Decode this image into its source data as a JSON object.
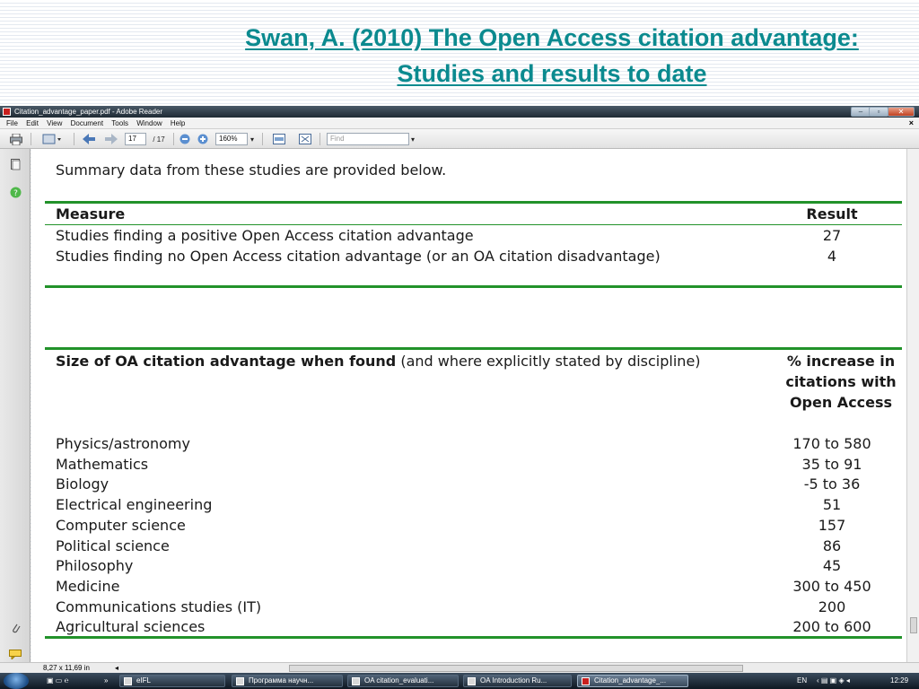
{
  "slide": {
    "title_line1": "Swan, A. (2010) The Open Access citation advantage:",
    "title_line2": "Studies and results to date"
  },
  "window": {
    "title": "Citation_advantage_paper.pdf - Adobe Reader",
    "minimize": "–",
    "maximize": "▫",
    "close": "✕"
  },
  "menu": {
    "items": [
      "File",
      "Edit",
      "View",
      "Document",
      "Tools",
      "Window",
      "Help"
    ],
    "close": "×"
  },
  "toolbar": {
    "page_current": "17",
    "page_total": "/ 17",
    "zoom": "160%",
    "find_placeholder": "Find"
  },
  "document": {
    "intro": "Summary data from these studies are provided below.",
    "table1": {
      "headers": [
        "Measure",
        "Result"
      ],
      "rows": [
        [
          "Studies finding a positive Open Access citation advantage",
          "27"
        ],
        [
          "Studies finding no Open Access citation advantage (or an OA citation disadvantage)",
          "4"
        ]
      ]
    },
    "table2": {
      "header_bold": "Size of OA citation advantage when found",
      "header_rest": " (and where explicitly stated by discipline)",
      "result_header": "% increase in citations with Open Access",
      "rows": [
        [
          "Physics/astronomy",
          "170 to 580"
        ],
        [
          "Mathematics",
          "35 to 91"
        ],
        [
          "Biology",
          "-5 to 36"
        ],
        [
          "Electrical engineering",
          "51"
        ],
        [
          "Computer science",
          "157"
        ],
        [
          "Political science",
          "86"
        ],
        [
          "Philosophy",
          "45"
        ],
        [
          "Medicine",
          "300 to 450"
        ],
        [
          "Communications studies (IT)",
          "200"
        ],
        [
          "Agricultural sciences",
          "200 to 600"
        ]
      ]
    }
  },
  "status": {
    "page_size": "8,27 x 11,69 in"
  },
  "taskbar": {
    "buttons": [
      "eIFL",
      "Программа научн...",
      "OA citation_evaluati...",
      "OA Introduction Ru...",
      "Citation_advantage_..."
    ],
    "language": "EN",
    "clock": "12:29"
  },
  "colors": {
    "title": "#0b8a8f",
    "table_rule": "#22922a"
  }
}
